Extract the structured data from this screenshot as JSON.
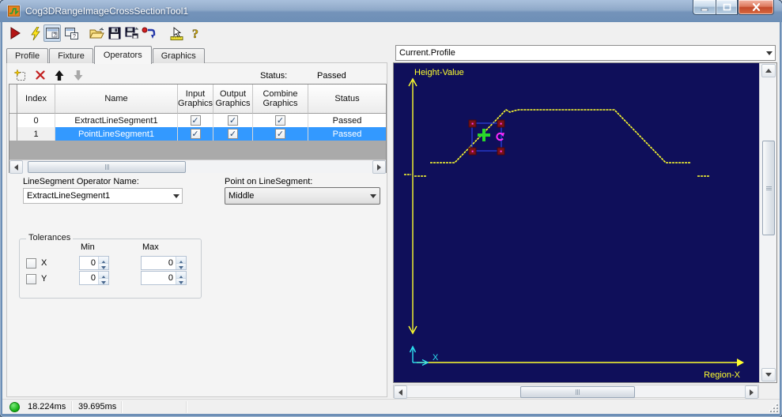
{
  "window": {
    "title": "Cog3DRangeImageCrossSectionTool1",
    "buttons": [
      "minimize",
      "maximize",
      "close"
    ]
  },
  "toolbar": {
    "icons": [
      "run-tool",
      "run-continuous",
      "show-current-record",
      "float-display",
      "open-file",
      "save-file",
      "save-file-as",
      "reset-tool",
      "electrode-position",
      "help"
    ]
  },
  "tabs": [
    "Profile",
    "Fixture",
    "Operators",
    "Graphics"
  ],
  "operators_panel": {
    "mini_toolbar": [
      "add-operator",
      "delete-operator",
      "move-operator-up",
      "move-operator-down"
    ],
    "status_label": "Status:",
    "status_value": "Passed",
    "table": {
      "columns": [
        "Index",
        "Name",
        "Input Graphics",
        "Output Graphics",
        "Combine Graphics",
        "Status"
      ],
      "rows": [
        {
          "index": "0",
          "name": "ExtractLineSegment1",
          "input": true,
          "output": true,
          "combine": true,
          "status": "Passed",
          "selected": false
        },
        {
          "index": "1",
          "name": "PointLineSegment1",
          "input": true,
          "output": true,
          "combine": true,
          "status": "Passed",
          "selected": true
        }
      ]
    },
    "operator_name_combo": {
      "label": "LineSegment Operator Name:",
      "value": "ExtractLineSegment1"
    },
    "point_combo": {
      "label": "Point on LineSegment:",
      "value": "Middle"
    },
    "tolerances": {
      "title": "Tolerances",
      "min_label": "Min",
      "max_label": "Max",
      "rows": [
        {
          "axis": "X",
          "checked": false,
          "min": "0",
          "max": "0"
        },
        {
          "axis": "Y",
          "checked": false,
          "min": "0",
          "max": "0"
        }
      ]
    }
  },
  "display_panel": {
    "selector_value": "Current.Profile",
    "y_axis_label": "Height-Value",
    "x_axis_label": "Region-X",
    "mini_axis_label": "X",
    "profile_segments": [
      [
        [
          13,
          141
        ],
        [
          22,
          141
        ]
      ],
      [
        [
          26,
          143
        ],
        [
          42,
          143
        ]
      ],
      [
        [
          46,
          126
        ],
        [
          77,
          126
        ],
        [
          142,
          59
        ],
        [
          147,
          62
        ],
        [
          153,
          60
        ],
        [
          158,
          59
        ],
        [
          279,
          59
        ],
        [
          344,
          126
        ],
        [
          376,
          126
        ]
      ],
      [
        [
          384,
          143
        ],
        [
          399,
          143
        ]
      ]
    ]
  },
  "status_bar": {
    "time1": "18.224ms",
    "time2": "39.695ms"
  },
  "colors": {
    "selection": "#3399ff",
    "graph_bg": "#0f0f5a",
    "profile_yellow": "#ffff2e",
    "axis_cyan": "#2de2f2",
    "status_green": "#17b317"
  }
}
